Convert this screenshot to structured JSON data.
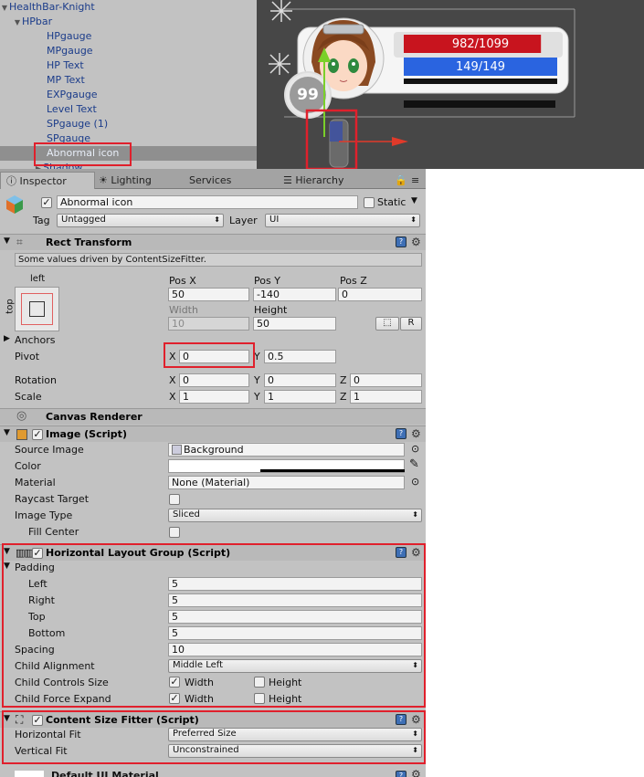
{
  "hierarchy": {
    "items": [
      {
        "label": "HealthBar-Knight"
      },
      {
        "label": "HPbar"
      },
      {
        "label": "HPgauge"
      },
      {
        "label": "MPgauge"
      },
      {
        "label": "HP Text"
      },
      {
        "label": "MP Text"
      },
      {
        "label": "EXPgauge"
      },
      {
        "label": "Level Text"
      },
      {
        "label": "SPgauge (1)"
      },
      {
        "label": "SPgauge"
      },
      {
        "label": "Abnormal icon"
      },
      {
        "label": "Shadow"
      }
    ]
  },
  "scene": {
    "hp_text": "982/1099",
    "mp_text": "149/149",
    "level_text": "99",
    "hp_fill": 0.894,
    "mp_fill": 1.0
  },
  "tabs": {
    "inspector": "Inspector",
    "lighting": "Lighting",
    "services": "Services",
    "hierarchy": "Hierarchy"
  },
  "object": {
    "name": "Abnormal icon",
    "static_label": "Static",
    "tag_label": "Tag",
    "tag_value": "Untagged",
    "layer_label": "Layer",
    "layer_value": "UI"
  },
  "rect_transform": {
    "title": "Rect Transform",
    "note": "Some values driven by ContentSizeFitter.",
    "anchor_h": "left",
    "anchor_v": "top",
    "pos_x_label": "Pos X",
    "pos_y_label": "Pos Y",
    "pos_z_label": "Pos Z",
    "pos_x": "50",
    "pos_y": "-140",
    "pos_z": "0",
    "width_label": "Width",
    "height_label": "Height",
    "width": "10",
    "height": "50",
    "r_button": "R",
    "anchors_label": "Anchors",
    "pivot_label": "Pivot",
    "pivot_x": "0",
    "pivot_y": "0.5",
    "rotation_label": "Rotation",
    "rot_x": "0",
    "rot_y": "0",
    "rot_z": "0",
    "scale_label": "Scale",
    "scale_x": "1",
    "scale_y": "1",
    "scale_z": "1",
    "x": "X",
    "y": "Y",
    "z": "Z"
  },
  "canvas_renderer": {
    "title": "Canvas Renderer"
  },
  "image": {
    "title": "Image (Script)",
    "source_label": "Source Image",
    "source_value": "Background",
    "color_label": "Color",
    "material_label": "Material",
    "material_value": "None (Material)",
    "raycast_label": "Raycast Target",
    "type_label": "Image Type",
    "type_value": "Sliced",
    "fill_label": "Fill Center"
  },
  "hlg": {
    "title": "Horizontal Layout Group (Script)",
    "padding_label": "Padding",
    "left_label": "Left",
    "left": "5",
    "right_label": "Right",
    "right": "5",
    "top_label": "Top",
    "top": "5",
    "bottom_label": "Bottom",
    "bottom": "5",
    "spacing_label": "Spacing",
    "spacing": "10",
    "align_label": "Child Alignment",
    "align_value": "Middle Left",
    "controls_label": "Child Controls Size",
    "expand_label": "Child Force Expand",
    "width_label": "Width",
    "height_label": "Height"
  },
  "csf": {
    "title": "Content Size Fitter (Script)",
    "hfit_label": "Horizontal Fit",
    "hfit_value": "Preferred Size",
    "vfit_label": "Vertical Fit",
    "vfit_value": "Unconstrained"
  },
  "material_footer": {
    "label": "Default UI Material"
  },
  "colors": {
    "highlight": "#e0202c",
    "hp_bar": "#c8141e",
    "mp_bar": "#2a64e0",
    "selection": "#8f8f8f"
  }
}
